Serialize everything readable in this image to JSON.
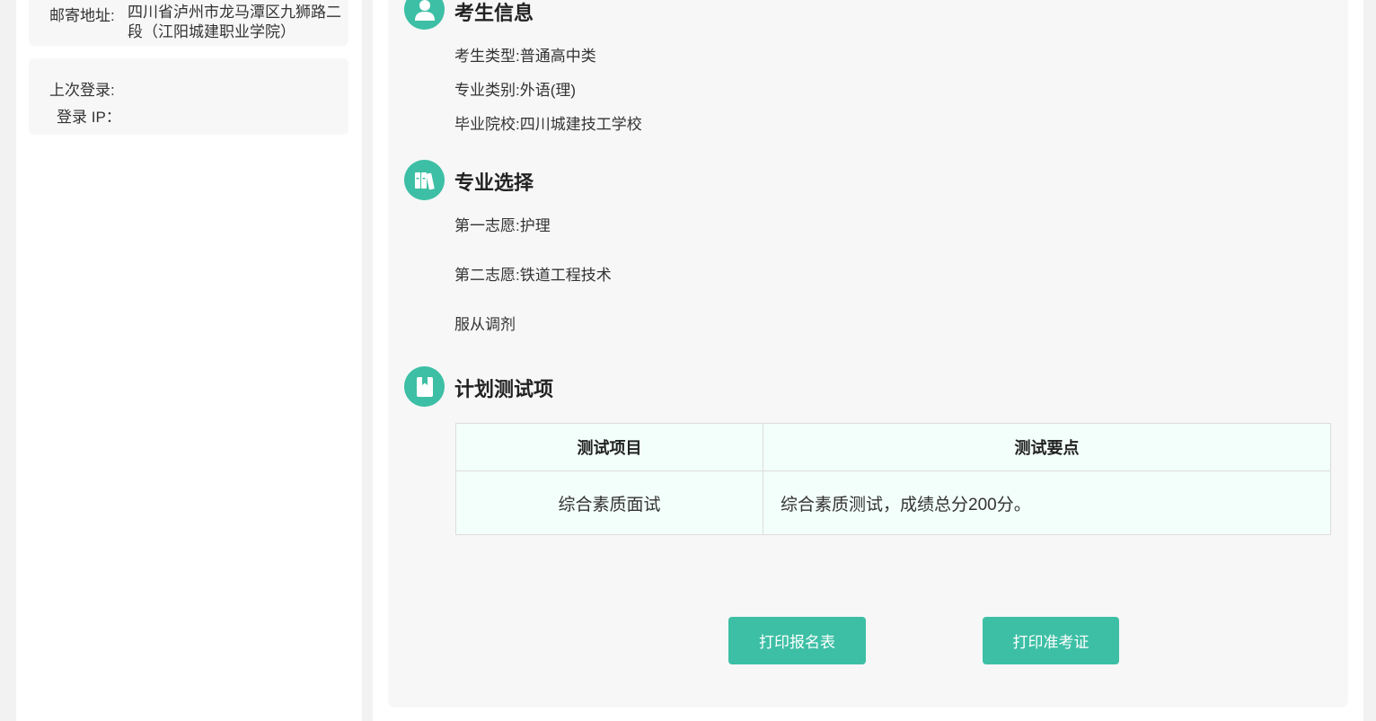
{
  "sidebar": {
    "address_label": "邮寄地址:",
    "address_value": "四川省泸州市龙马潭区九狮路二段（江阳城建职业学院）",
    "last_login_label": "上次登录:",
    "last_login_value": "",
    "login_ip_label": "登录 IP：",
    "login_ip_value": ""
  },
  "sections": {
    "student_info": {
      "title": "考生信息",
      "icon": "user-icon",
      "rows": [
        {
          "label": "考生类型:",
          "value": "普通高中类"
        },
        {
          "label": "专业类别:",
          "value": "外语(理)"
        },
        {
          "label": "毕业院校:",
          "value": "四川城建技工学校"
        }
      ]
    },
    "major_choice": {
      "title": "专业选择",
      "icon": "books-icon",
      "first_label": "第一志愿:",
      "first_value": "护理",
      "second_label": "第二志愿:",
      "second_value": "铁道工程技术",
      "obey": "服从调剂"
    },
    "test_plan": {
      "title": "计划测试项",
      "icon": "bookmark-icon",
      "columns": [
        "测试项目",
        "测试要点"
      ],
      "rows": [
        {
          "item": "综合素质面试",
          "point": "综合素质测试，成绩总分200分。"
        }
      ]
    }
  },
  "buttons": {
    "print_form": "打印报名表",
    "print_ticket": "打印准考证"
  },
  "colors": {
    "accent": "#3dbfa5",
    "table_bg": "#f3fffb"
  }
}
